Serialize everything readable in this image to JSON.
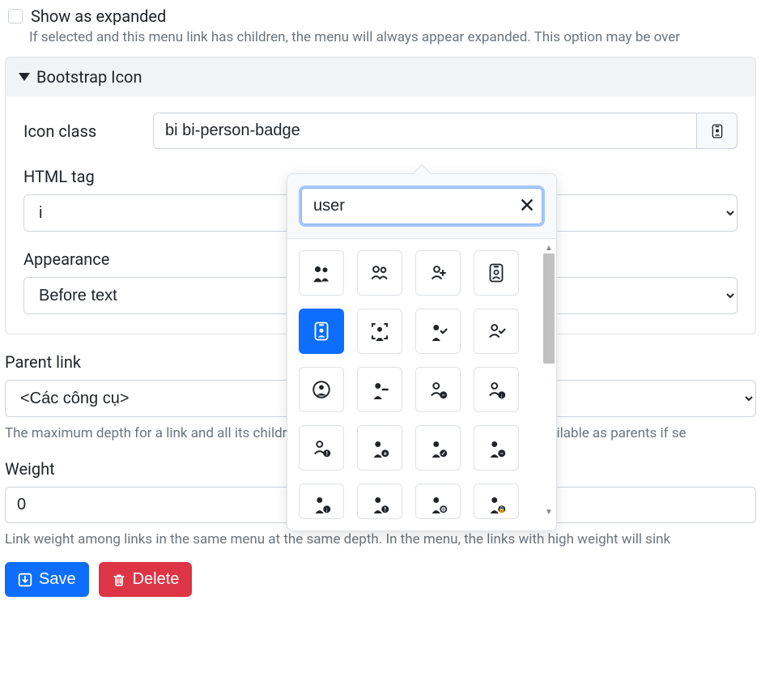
{
  "expanded": {
    "label": "Show as expanded",
    "help": "If selected and this menu link has children, the menu will always appear expanded. This option may be over"
  },
  "details": {
    "title": "Bootstrap Icon",
    "icon_class": {
      "label": "Icon class",
      "value": "bi bi-person-badge"
    },
    "html_tag": {
      "label": "HTML tag",
      "value": "i"
    },
    "appearance": {
      "label": "Appearance",
      "value": "Before text"
    }
  },
  "parent_link": {
    "label": "Parent link",
    "value": "<Các công cụ>",
    "help": "The maximum depth for a link and all its children is fixed. Some menu links may not be available as parents if se"
  },
  "weight": {
    "label": "Weight",
    "value": "0",
    "help": "Link weight among links in the same menu at the same depth. In the menu, the links with high weight will sink "
  },
  "buttons": {
    "save": "Save",
    "delete": "Delete"
  },
  "popover": {
    "search_value": "user",
    "icons": [
      "people-fill",
      "people",
      "person-plus",
      "person-badge",
      "person-badge-fill",
      "person-bounding-box",
      "person-check-fill",
      "person-check",
      "person-circle",
      "person-dash-fill",
      "person-dash",
      "person-down",
      "person-exclamation",
      "person-fill-add",
      "person-fill-check",
      "person-fill-dash",
      "person-fill-down",
      "person-fill-exclamation",
      "person-fill-gear",
      "person-fill-lock"
    ],
    "selected_index": 4
  }
}
